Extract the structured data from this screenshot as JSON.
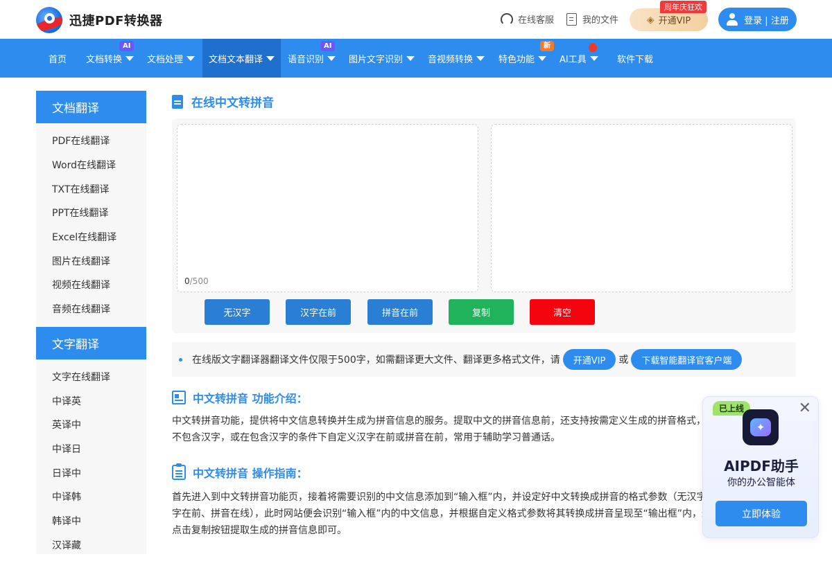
{
  "header": {
    "brand": "迅捷PDF转换器",
    "service_label": "在线客服",
    "files_label": "我的文件",
    "vip_label": "开通VIP",
    "promo_tag": "周年庆狂欢",
    "login_label": "登录 | 注册"
  },
  "nav": {
    "items": [
      {
        "label": "首页",
        "dropdown": false
      },
      {
        "label": "文档转换",
        "dropdown": true,
        "badge": "AI"
      },
      {
        "label": "文档处理",
        "dropdown": true
      },
      {
        "label": "文档文本翻译",
        "dropdown": true,
        "active": true
      },
      {
        "label": "语音识别",
        "dropdown": true,
        "badge": "AI"
      },
      {
        "label": "图片文字识别",
        "dropdown": true
      },
      {
        "label": "音视频转换",
        "dropdown": true
      },
      {
        "label": "特色功能",
        "dropdown": true,
        "badge": "新"
      },
      {
        "label": "AI工具",
        "dropdown": true,
        "badge_icon": "flame-icon"
      },
      {
        "label": "软件下载",
        "dropdown": false
      }
    ]
  },
  "sidebar": {
    "groups": [
      {
        "title": "文档翻译",
        "items": [
          "PDF在线翻译",
          "Word在线翻译",
          "TXT在线翻译",
          "PPT在线翻译",
          "Excel在线翻译",
          "图片在线翻译",
          "视频在线翻译",
          "音频在线翻译"
        ]
      },
      {
        "title": "文字翻译",
        "items": [
          "文字在线翻译",
          "中译英",
          "英译中",
          "中译日",
          "日译中",
          "中译韩",
          "韩译中",
          "汉译藏"
        ]
      }
    ]
  },
  "main": {
    "title": "在线中文转拼音",
    "input": {
      "value": "",
      "placeholder": "",
      "count": "0",
      "max": "/500"
    },
    "output": {
      "value": ""
    },
    "buttons": [
      "无汉字",
      "汉字在前",
      "拼音在前",
      "复制",
      "清空"
    ],
    "notice": {
      "text": "在线版文字翻译器翻译文件仅限于500字，如需翻译更大文件、翻译更多格式文件，请",
      "vip_button": "开通VIP",
      "or": "或",
      "download_button": "下载智能翻译官客户端"
    },
    "intro": {
      "title": "中文转拼音 功能介绍：",
      "text": "中文转拼音功能，提供将中文信息转换并生成为拼音信息的服务。提取中文的拼音信息前，还支持按需定义生成的拼音格式，如在不包含汉字，或在包含汉字的条件下自定义汉字在前或拼音在前，常用于辅助学习普通话。"
    },
    "guide": {
      "title": "中文转拼音 操作指南：",
      "text": "首先进入到中文转拼音功能页，接着将需要识别的中文信息添加到“输入框”内，并设定好中文转换成拼音的格式参数（无汉字、汉字在前、拼音在线），此时网站便会识别“输入框”内的中文信息，并根据自定义格式参数将其转换成拼音呈现至“输出框”内，最后点击复制按钮提取生成的拼音信息即可。"
    }
  },
  "ai_card": {
    "tag": "已上线",
    "name": "AIPDF助手",
    "subtitle": "你的办公智能体",
    "button": "立即体验",
    "close": "✕"
  },
  "colors": {
    "primary": "#2f8cef",
    "nav_active": "#1f6fcf",
    "copy_green": "#21b35c",
    "clear_red": "#f3050f",
    "promo_red": "#f03a3a"
  }
}
